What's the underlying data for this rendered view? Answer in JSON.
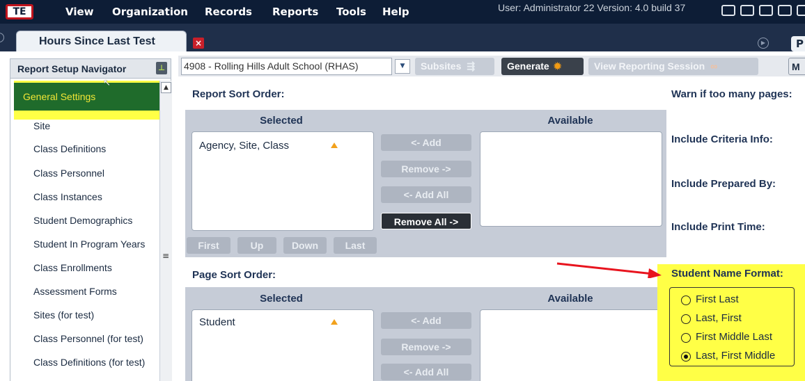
{
  "menu": {
    "logo": "TE",
    "items": [
      "View",
      "Organization",
      "Records",
      "Reports",
      "Tools",
      "Help"
    ],
    "user_info": "User: Administrator 22   Version: 4.0 build 37"
  },
  "tab": {
    "title": "Hours Since Last Test",
    "p_label": "P"
  },
  "navigator": {
    "title": "Report Setup Navigator",
    "selected": "General Settings",
    "items": [
      "Site",
      "Class Definitions",
      "Class Personnel",
      "Class Instances",
      "Student Demographics",
      "Student In Program Years",
      "Class Enrollments",
      "Assessment Forms",
      "Sites (for test)",
      "Class Personnel (for test)",
      "Class Definitions (for test)"
    ]
  },
  "toolbar": {
    "agency": "4908 - Rolling Hills Adult School (RHAS)",
    "subsites": "Subsites",
    "generate": "Generate",
    "view_session": "View Reporting Session",
    "more": "M"
  },
  "report_sort": {
    "heading": "Report Sort Order:",
    "selected_header": "Selected",
    "available_header": "Available",
    "selected_items": [
      "Agency, Site, Class"
    ],
    "buttons": {
      "add": "<- Add",
      "remove": "Remove ->",
      "add_all": "<- Add All",
      "remove_all": "Remove All ->"
    },
    "order": {
      "first": "First",
      "up": "Up",
      "down": "Down",
      "last": "Last"
    }
  },
  "page_sort": {
    "heading": "Page Sort Order:",
    "selected_header": "Selected",
    "available_header": "Available",
    "selected_items": [
      "Student"
    ],
    "buttons": {
      "add": "<- Add",
      "remove": "Remove ->",
      "add_all": "<- Add All"
    }
  },
  "options": {
    "warn": "Warn if too many pages:",
    "criteria": "Include Criteria Info:",
    "prepared": "Include Prepared By:",
    "print_time": "Include Print Time:",
    "student_name_format": "Student Name Format:",
    "name_formats": [
      "First Last",
      "Last, First",
      "First Middle Last",
      "Last, First Middle"
    ],
    "selected_format": "Last, First Middle"
  },
  "colors": {
    "highlight": "#ffff46",
    "arrow": "#e8141e",
    "nav_selected": "#1f6b2b"
  }
}
